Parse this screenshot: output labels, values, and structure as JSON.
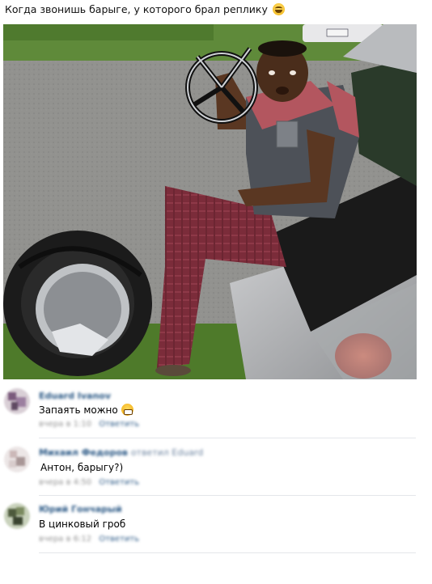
{
  "post": {
    "title": "Когда звонишь барыге, у которого брал реплику",
    "title_emoji": "laughing-emoji"
  },
  "photo": {
    "description_icon": "meme-photo"
  },
  "comments": [
    {
      "author": "Eduard Ivanov",
      "reply_to": "",
      "text": "Запаять можно",
      "emoji": "grin-emoji",
      "date": "вчера в 1:10",
      "reply_label": "Ответить",
      "avatar_color": "#8a6f8c"
    },
    {
      "author": "Михаил Федоров",
      "reply_to": "ответил Eduard",
      "text": "Антон, барыгу?)",
      "emoji": "",
      "date": "вчера в 4:50",
      "reply_label": "Ответить",
      "avatar_color": "#b8a8a8"
    },
    {
      "author": "Юрий Гончарый",
      "reply_to": "",
      "text": "В цинковый гроб",
      "emoji": "",
      "date": "вчера в 6:12",
      "reply_label": "Ответить",
      "avatar_color": "#5d6b4a"
    }
  ],
  "colors": {
    "link": "#2a5885",
    "meta": "#939393",
    "divider": "#e4e6ea"
  }
}
